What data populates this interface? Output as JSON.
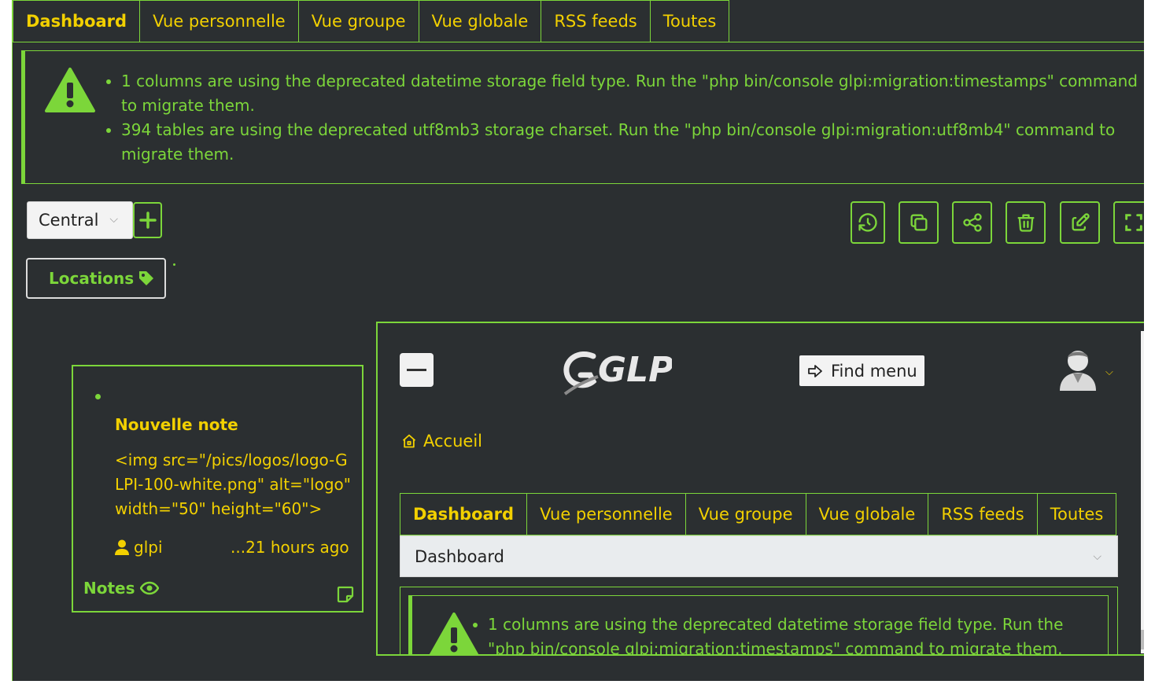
{
  "tabs": [
    {
      "label": "Dashboard",
      "active": true
    },
    {
      "label": "Vue personnelle",
      "active": false
    },
    {
      "label": "Vue groupe",
      "active": false
    },
    {
      "label": "Vue globale",
      "active": false
    },
    {
      "label": "RSS feeds",
      "active": false
    },
    {
      "label": "Toutes",
      "active": false
    }
  ],
  "alert": {
    "icon": "warning-triangle-icon",
    "messages": [
      "1 columns are using the deprecated datetime storage field type. Run the \"php bin/console glpi:migration:timestamps\" command to migrate them.",
      "394 tables are using the deprecated utf8mb3 storage charset. Run the \"php bin/console glpi:migration:utf8mb4\" command to migrate them."
    ]
  },
  "toolbar": {
    "dashboard_select": "Central",
    "add_icon": "plus-icon",
    "actions": [
      {
        "name": "history-icon"
      },
      {
        "name": "clone-icon"
      },
      {
        "name": "share-icon"
      },
      {
        "name": "trash-icon"
      },
      {
        "name": "edit-icon"
      },
      {
        "name": "fullscreen-icon"
      }
    ]
  },
  "filter": {
    "label": "Locations",
    "icon": "tag-icon"
  },
  "notes_widget": {
    "note_title": "Nouvelle note",
    "note_content": "<img src=\"/pics/logos/logo-GLPI-100-white.png\" alt=\"logo\" width=\"50\" height=\"60\">",
    "author": "glpi",
    "time": "...21 hours ago",
    "footer_label": "Notes",
    "footer_icon": "eye-icon",
    "add_icon": "sticky-note-icon"
  },
  "embedded": {
    "logo_text": "GLPI",
    "find_menu": "Find menu",
    "breadcrumb": "Accueil",
    "tabs": [
      {
        "label": "Dashboard",
        "active": true
      },
      {
        "label": "Vue personnelle",
        "active": false
      },
      {
        "label": "Vue groupe",
        "active": false
      },
      {
        "label": "Vue globale",
        "active": false
      },
      {
        "label": "RSS feeds",
        "active": false
      },
      {
        "label": "Toutes",
        "active": false
      }
    ],
    "dashboard_select": "Dashboard",
    "alert_messages": [
      "1 columns are using the deprecated datetime storage field type. Run the \"php bin/console glpi:migration:timestamps\" command to migrate them."
    ]
  },
  "colors": {
    "accent": "#7cd63a",
    "link": "#f2d000",
    "background": "#2b2f31"
  }
}
